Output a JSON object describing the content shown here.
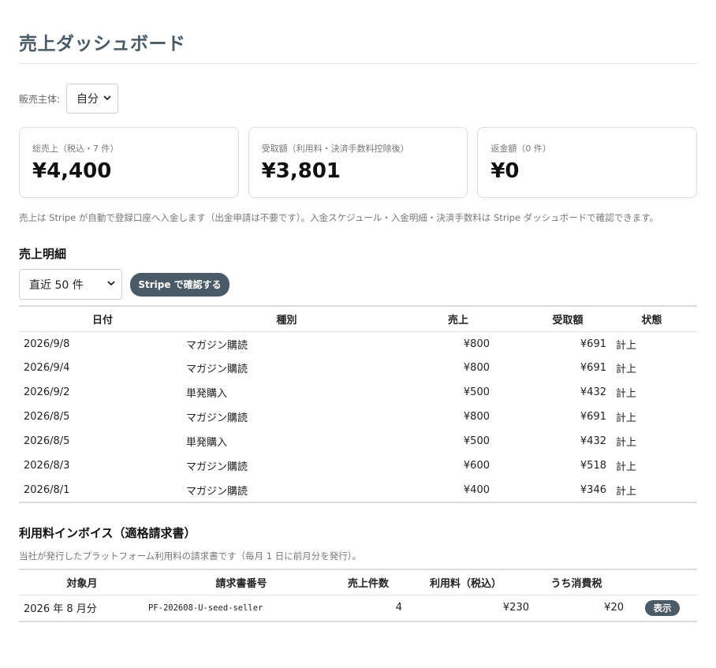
{
  "page": {
    "title": "売上ダッシュボード"
  },
  "seller": {
    "label": "販売主体:",
    "selected": "自分"
  },
  "cards": [
    {
      "label": "総売上（税込・7 件）",
      "value": "¥4,400"
    },
    {
      "label": "受取額（利用料・決済手数料控除後）",
      "value": "¥3,801"
    },
    {
      "label": "返金額（0 件）",
      "value": "¥0"
    }
  ],
  "note": "売上は Stripe が自動で登録口座へ入金します（出金申請は不要です）。入金スケジュール・入金明細・決済手数料は Stripe ダッシュボードで確認できます。",
  "sales": {
    "title": "売上明細",
    "limit_selected": "直近 50 件",
    "stripe_button": "Stripe で確認する",
    "headers": [
      "日付",
      "種別",
      "売上",
      "受取額",
      "状態"
    ],
    "rows": [
      [
        "2026/9/8",
        "マガジン購読",
        "¥800",
        "¥691",
        "計上"
      ],
      [
        "2026/9/4",
        "マガジン購読",
        "¥800",
        "¥691",
        "計上"
      ],
      [
        "2026/9/2",
        "単発購入",
        "¥500",
        "¥432",
        "計上"
      ],
      [
        "2026/8/5",
        "マガジン購読",
        "¥800",
        "¥691",
        "計上"
      ],
      [
        "2026/8/5",
        "単発購入",
        "¥500",
        "¥432",
        "計上"
      ],
      [
        "2026/8/3",
        "マガジン購読",
        "¥600",
        "¥518",
        "計上"
      ],
      [
        "2026/8/1",
        "マガジン購読",
        "¥400",
        "¥346",
        "計上"
      ]
    ]
  },
  "invoices": {
    "title": "利用料インボイス（適格請求書）",
    "description": "当社が発行したプラットフォーム利用料の請求書です（毎月 1 日に前月分を発行）。",
    "headers": [
      "対象月",
      "請求書番号",
      "売上件数",
      "利用料（税込）",
      "うち消費税"
    ],
    "rows": [
      [
        "2026 年 8 月分",
        "PF-202608-U-seed-seller",
        "4",
        "¥230",
        "¥20",
        "表示"
      ]
    ]
  },
  "colors": {
    "accent": "#4a5a66",
    "border": "#dcdcdc",
    "muted_text": "#777777"
  },
  "icons": {
    "select_chevron": "chevron-down-icon"
  }
}
